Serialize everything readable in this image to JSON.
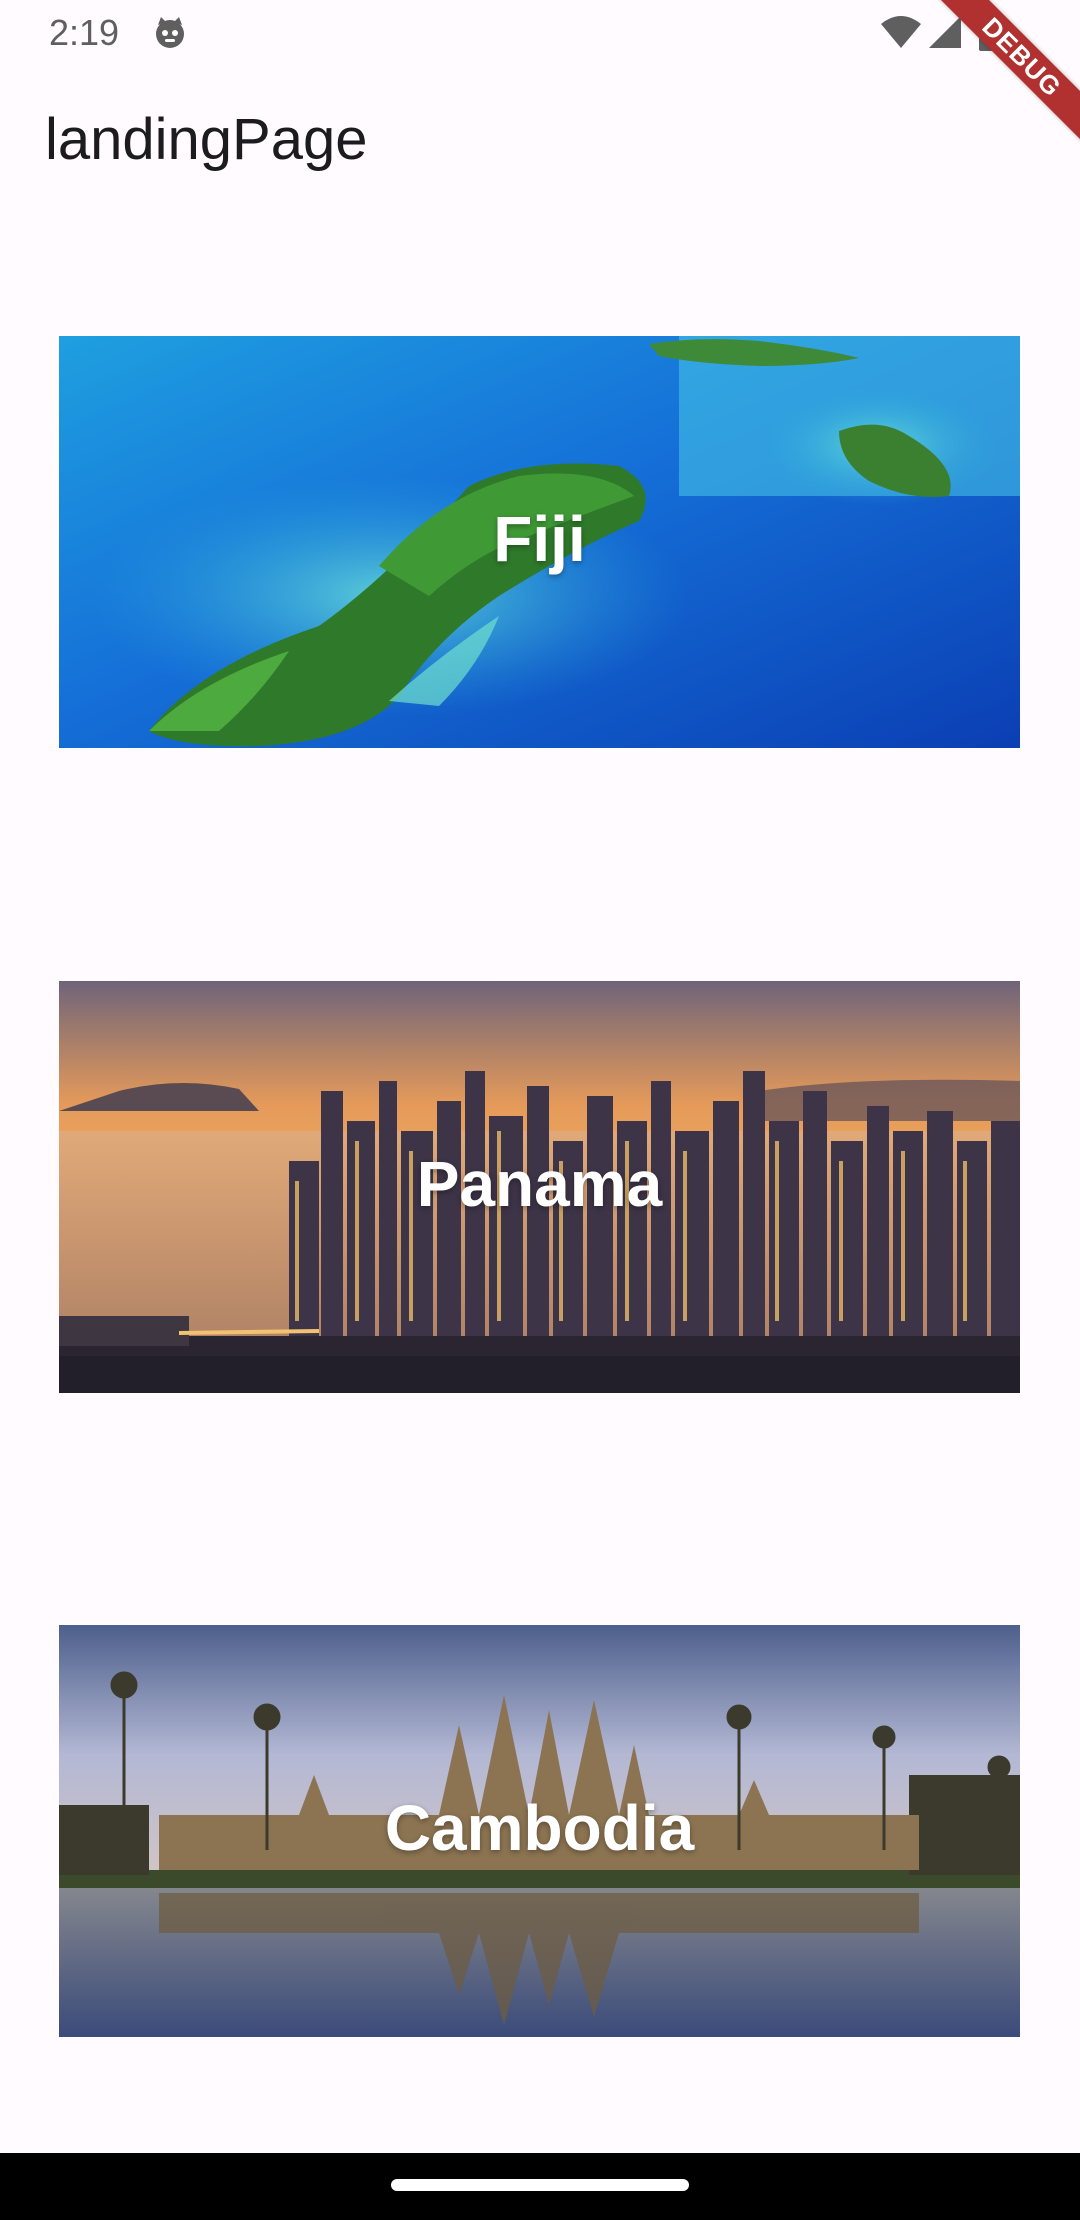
{
  "status_bar": {
    "time": "2:19",
    "app_icon": "cat-face-icon",
    "wifi_icon": "wifi-icon",
    "signal_icon": "cellular-signal-icon",
    "battery_icon": "battery-icon"
  },
  "debug_banner": {
    "label": "DEBUG",
    "color": "#b0312f"
  },
  "app_bar": {
    "title": "landingPage"
  },
  "destinations": [
    {
      "label": "Fiji"
    },
    {
      "label": "Panama"
    },
    {
      "label": "Cambodia"
    }
  ],
  "colors": {
    "background": "#fffbfe",
    "title_text": "#1c1b1f",
    "nav_bar": "#000000"
  }
}
